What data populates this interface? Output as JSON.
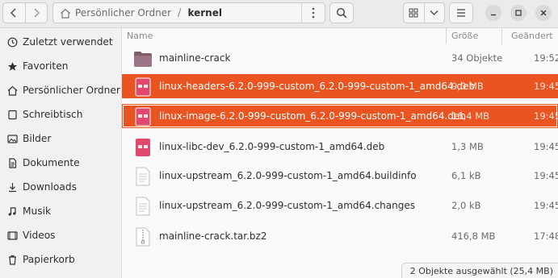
{
  "header": {
    "path": [
      "Persönlicher Ordner",
      "kernel"
    ],
    "path_separator": "/"
  },
  "sidebar": {
    "items": [
      {
        "label": "Zuletzt verwendet",
        "icon": "clock-icon"
      },
      {
        "label": "Favoriten",
        "icon": "star-icon"
      },
      {
        "label": "Persönlicher Ordner",
        "icon": "home-icon"
      },
      {
        "label": "Schreibtisch",
        "icon": "desktop-icon"
      },
      {
        "label": "Bilder",
        "icon": "pictures-icon"
      },
      {
        "label": "Dokumente",
        "icon": "document-icon"
      },
      {
        "label": "Downloads",
        "icon": "download-icon"
      },
      {
        "label": "Musik",
        "icon": "music-icon"
      },
      {
        "label": "Videos",
        "icon": "video-icon"
      },
      {
        "label": "Papierkorb",
        "icon": "trash-icon"
      }
    ]
  },
  "columns": {
    "name": "Name",
    "size": "Größe",
    "modified": "Geändert"
  },
  "files": [
    {
      "name": "mainline-crack",
      "size": "34 Objekte",
      "modified": "19:52",
      "type": "folder",
      "selected": false
    },
    {
      "name": "linux-headers-6.2.0-999-custom_6.2.0-999-custom-1_amd64.deb",
      "size": "9,0 MB",
      "modified": "19:45",
      "type": "deb",
      "selected": true
    },
    {
      "name": "linux-image-6.2.0-999-custom_6.2.0-999-custom-1_amd64.deb",
      "size": "16,4 MB",
      "modified": "19:45",
      "type": "deb",
      "selected": true
    },
    {
      "name": "linux-libc-dev_6.2.0-999-custom-1_amd64.deb",
      "size": "1,3 MB",
      "modified": "19:45",
      "type": "deb",
      "selected": false
    },
    {
      "name": "linux-upstream_6.2.0-999-custom-1_amd64.buildinfo",
      "size": "6,1 kB",
      "modified": "19:45",
      "type": "text",
      "selected": false
    },
    {
      "name": "linux-upstream_6.2.0-999-custom-1_amd64.changes",
      "size": "2,0 kB",
      "modified": "19:45",
      "type": "text",
      "selected": false
    },
    {
      "name": "mainline-crack.tar.bz2",
      "size": "416,8 MB",
      "modified": "17:48",
      "type": "archive",
      "selected": false
    }
  ],
  "status": "2 Objekte ausgewählt (25,4 MB)",
  "colors": {
    "accent": "#e95420",
    "folder": "#8b6b78",
    "deb": "#e0486e"
  }
}
